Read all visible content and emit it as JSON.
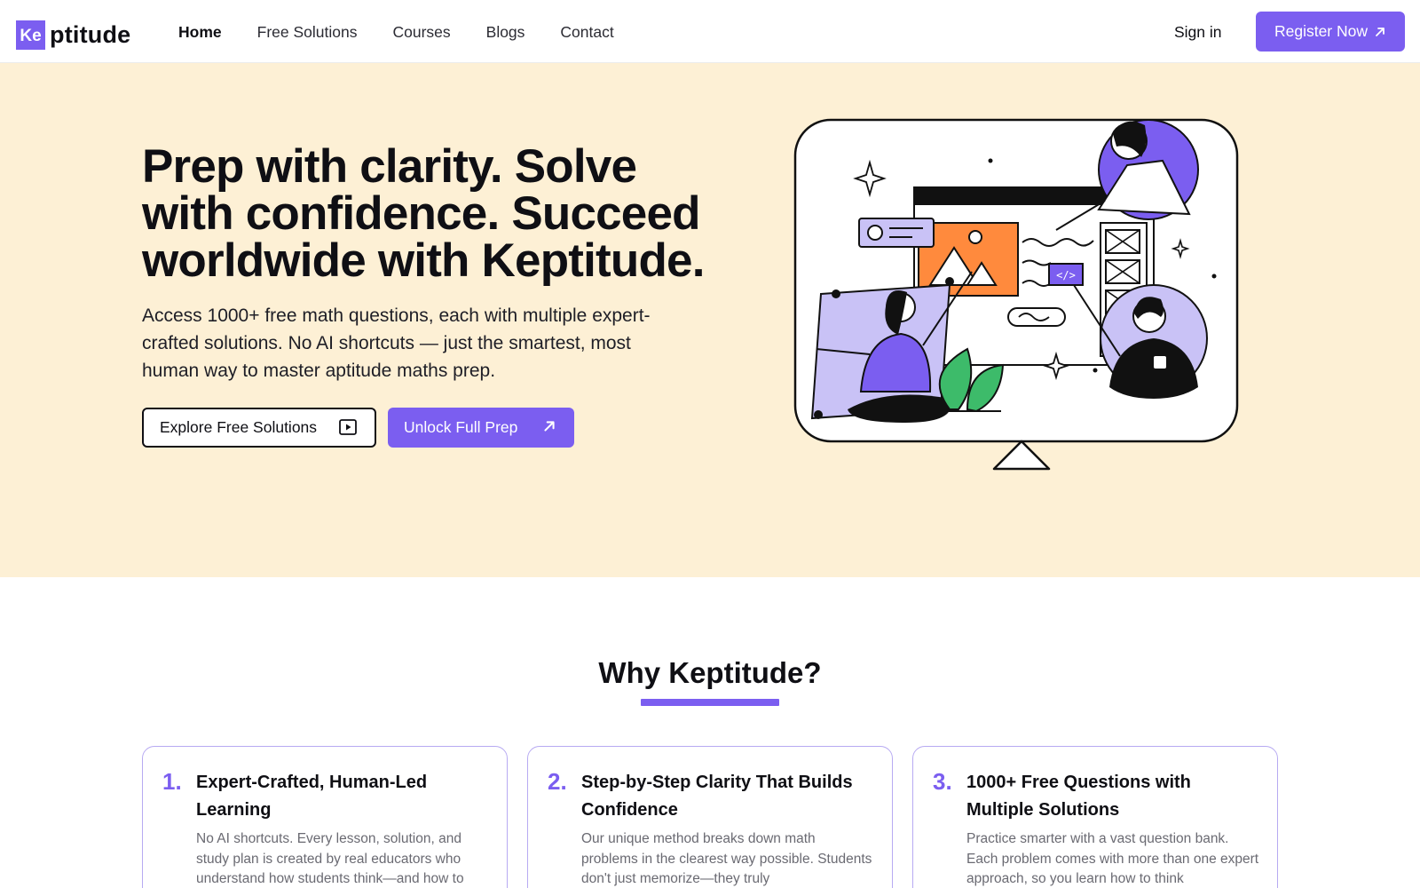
{
  "brand": {
    "logo_mark": "Ke",
    "logo_text": "ptitude",
    "accent": "#7b5ef0",
    "hero_bg": "#fdf0d5"
  },
  "nav": {
    "links": [
      {
        "label": "Home",
        "active": true
      },
      {
        "label": "Free Solutions",
        "active": false
      },
      {
        "label": "Courses",
        "active": false
      },
      {
        "label": "Blogs",
        "active": false
      },
      {
        "label": "Contact",
        "active": false
      }
    ],
    "signin_label": "Sign in",
    "register_label": "Register Now"
  },
  "hero": {
    "title": "Prep with clarity. Solve with confidence. Succeed worldwide with Keptitude.",
    "subtitle": "Access 1000+ free math questions, each with multiple expert-crafted solutions. No AI shortcuts — just the smartest, most human way to master aptitude maths prep.",
    "explore_label": "Explore Free Solutions",
    "unlock_label": "Unlock Full Prep"
  },
  "why": {
    "title": "Why Keptitude?",
    "cards": [
      {
        "number": "1.",
        "title": "Expert-Crafted, Human-Led Learning",
        "body": "No AI shortcuts. Every lesson, solution, and study plan is created by real educators who understand how students think—and how to"
      },
      {
        "number": "2.",
        "title": "Step-by-Step Clarity That Builds Confidence",
        "body": "Our unique method breaks down math problems in the clearest way possible. Students don't just memorize—they truly"
      },
      {
        "number": "3.",
        "title": "1000+ Free Questions with Multiple Solutions",
        "body": "Practice smarter with a vast question bank. Each problem comes with more than one expert approach, so you learn how to think"
      }
    ]
  },
  "icons": {
    "register": "arrow-up-right-icon",
    "explore": "play-square-icon",
    "unlock": "arrow-up-right-icon"
  }
}
